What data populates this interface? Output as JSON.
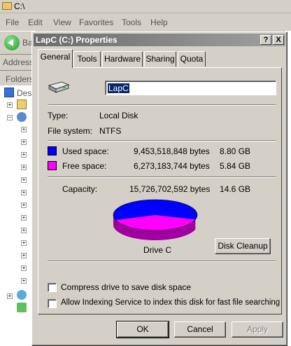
{
  "explorer": {
    "title": "C:\\",
    "menu": [
      "File",
      "Edit",
      "View",
      "Favorites",
      "Tools",
      "Help"
    ],
    "back_label": "Ba",
    "address_label": "Address",
    "folders_label": "Folders",
    "desktop_label": "Des"
  },
  "dialog": {
    "title": "LapC (C:) Properties",
    "help_btn": "?",
    "close_btn": "X",
    "tabs": [
      "General",
      "Tools",
      "Hardware",
      "Sharing",
      "Quota"
    ],
    "active_tab": "General",
    "drive_name": "LapC",
    "type_label": "Type:",
    "type_value": "Local Disk",
    "fs_label": "File system:",
    "fs_value": "NTFS",
    "used_label": "Used space:",
    "used_bytes": "9,453,518,848 bytes",
    "used_gb": "8.80 GB",
    "free_label": "Free space:",
    "free_bytes": "6,273,183,744 bytes",
    "free_gb": "5.84 GB",
    "capacity_label": "Capacity:",
    "capacity_bytes": "15,726,702,592 bytes",
    "capacity_gb": "14.6 GB",
    "drive_label": "Drive C",
    "disk_cleanup": "Disk Cleanup",
    "compress_label": "Compress drive to save disk space",
    "indexing_label": "Allow Indexing Service to index this disk for fast file searching",
    "ok": "OK",
    "cancel": "Cancel",
    "apply": "Apply",
    "used_color": "#0000ff",
    "free_color": "#ff00ff",
    "used_fraction": 0.601
  }
}
